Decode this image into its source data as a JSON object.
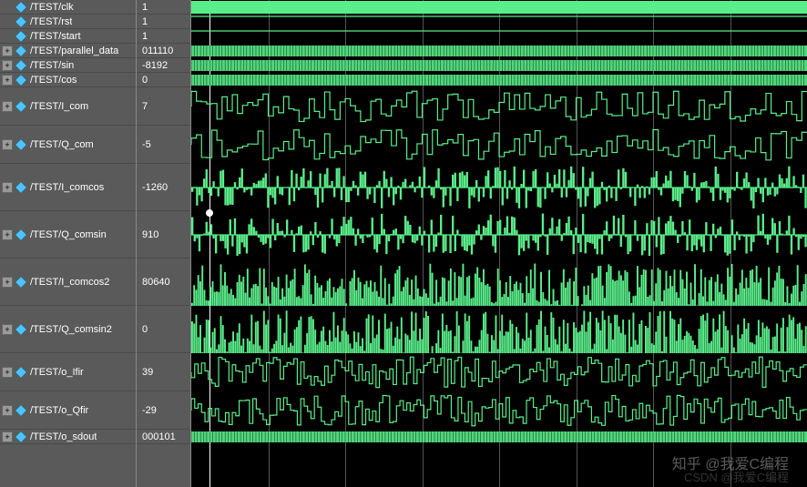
{
  "signals": [
    {
      "name": "/TEST/clk",
      "value": "1",
      "height": "small",
      "expandable": false,
      "waveType": "clock"
    },
    {
      "name": "/TEST/rst",
      "value": "1",
      "height": "small",
      "expandable": false,
      "waveType": "high"
    },
    {
      "name": "/TEST/start",
      "value": "1",
      "height": "small",
      "expandable": false,
      "waveType": "high"
    },
    {
      "name": "/TEST/parallel_data",
      "value": "011110",
      "height": "small",
      "expandable": true,
      "waveType": "bus"
    },
    {
      "name": "/TEST/sin",
      "value": "-8192",
      "height": "small",
      "expandable": true,
      "waveType": "bus"
    },
    {
      "name": "/TEST/cos",
      "value": "0",
      "height": "small",
      "expandable": true,
      "waveType": "bus"
    },
    {
      "name": "/TEST/I_com",
      "value": "7",
      "height": "med",
      "expandable": true,
      "waveType": "digital"
    },
    {
      "name": "/TEST/Q_com",
      "value": "-5",
      "height": "med",
      "expandable": true,
      "waveType": "digital"
    },
    {
      "name": "/TEST/I_comcos",
      "value": "-1260",
      "height": "large",
      "expandable": true,
      "waveType": "burst"
    },
    {
      "name": "/TEST/Q_comsin",
      "value": "910",
      "height": "large",
      "expandable": true,
      "waveType": "burst"
    },
    {
      "name": "/TEST/I_comcos2",
      "value": "80640",
      "height": "large",
      "expandable": true,
      "waveType": "dense"
    },
    {
      "name": "/TEST/Q_comsin2",
      "value": "0",
      "height": "large",
      "expandable": true,
      "waveType": "dense"
    },
    {
      "name": "/TEST/o_Ifir",
      "value": "39",
      "height": "med",
      "expandable": true,
      "waveType": "digital2"
    },
    {
      "name": "/TEST/o_Qfir",
      "value": "-29",
      "height": "med",
      "expandable": true,
      "waveType": "digital2"
    },
    {
      "name": "/TEST/o_sdout",
      "value": "000101",
      "height": "small",
      "expandable": true,
      "waveType": "bus"
    }
  ],
  "watermark1": "知乎 @我爱C编程",
  "watermark2": "CSDN @我爱C编程",
  "colors": {
    "wave_green": "#5aee8a",
    "bg_panel": "#5a5a5a"
  }
}
